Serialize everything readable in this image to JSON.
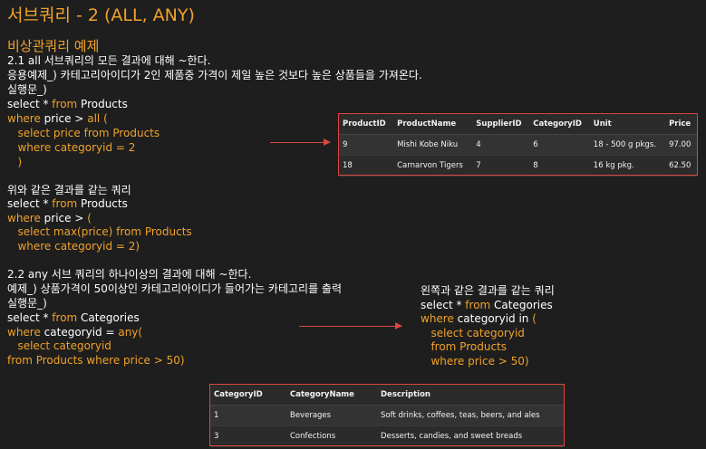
{
  "title": "서브쿼리 - 2 (ALL, ANY)",
  "subtitle": "비상관쿼리 예제",
  "section1": {
    "line1": "2.1 all 서브쿼리의 모든 결과에 대해 ~한다.",
    "line2": "응용예제_) 카테고리아이디가 2인 제품중 가격이 제일 높은 것보다 높은 상품들을 가져온다.",
    "line3": "실행문_)",
    "code": [
      {
        "k": "select * ",
        "o": "from",
        "r": " Products"
      },
      {
        "k": "where",
        "o": " price > ",
        "r": "all ("
      },
      {
        "k": "   select price from Products",
        "o": "",
        "r": ""
      },
      {
        "k": "   where categoryid = 2",
        "o": "",
        "r": ""
      },
      {
        "k": "   )",
        "o": "",
        "r": ""
      }
    ]
  },
  "same1": {
    "line1": "위와 같은 결과를 같는 쿼리",
    "code": [
      {
        "a": "select * ",
        "b": "from",
        "c": " Products"
      },
      {
        "a": "where",
        "b": " price > ",
        "c": "("
      },
      {
        "a": "   select max(price) from Products",
        "b": "",
        "c": ""
      },
      {
        "a": "   where categoryid = 2)",
        "b": "",
        "c": ""
      }
    ]
  },
  "section2": {
    "line1": "2.2 any 서브 쿼리의 하나이상의 결과에 대해 ~한다.",
    "line2": "예제_) 상품가격이 50이상인 카테고리아이디가 들어가는 카테고리를 출력",
    "line3": "실행문_)",
    "code": [
      {
        "a": "select * ",
        "b": "from",
        "c": " Categories"
      },
      {
        "a": "where",
        "b": " categoryid = ",
        "c": "any("
      },
      {
        "a": "   select categoryid",
        "b": "",
        "c": ""
      },
      {
        "a": "from Products where price > 50)",
        "b": "",
        "c": ""
      }
    ]
  },
  "same2": {
    "line1": "왼쪽과 같은 결과를 같는 쿼리",
    "code": [
      {
        "a": "select * ",
        "b": "from",
        "c": " Categories"
      },
      {
        "a": "where",
        "b": " categoryid in ",
        "c": "("
      },
      {
        "a": "   select categoryid",
        "b": "",
        "c": ""
      },
      {
        "a": "   from Products",
        "b": "",
        "c": ""
      },
      {
        "a": "   where price > 50)",
        "b": "",
        "c": ""
      }
    ]
  },
  "table1": {
    "headers": [
      "ProductID",
      "ProductName",
      "SupplierID",
      "CategoryID",
      "Unit",
      "Price"
    ],
    "rows": [
      [
        "9",
        "Mishi Kobe Niku",
        "4",
        "6",
        "18 - 500 g pkgs.",
        "97.00"
      ],
      [
        "18",
        "Carnarvon Tigers",
        "7",
        "8",
        "16 kg pkg.",
        "62.50"
      ]
    ]
  },
  "table2": {
    "headers": [
      "CategoryID",
      "CategoryName",
      "Description"
    ],
    "rows": [
      [
        "1",
        "Beverages",
        "Soft drinks, coffees, teas, beers, and ales"
      ],
      [
        "3",
        "Confections",
        "Desserts, candies, and sweet breads"
      ]
    ]
  },
  "colors": {
    "accent": "#f0a22a",
    "arrow": "#d9473f",
    "background": "#1e1e1e"
  }
}
